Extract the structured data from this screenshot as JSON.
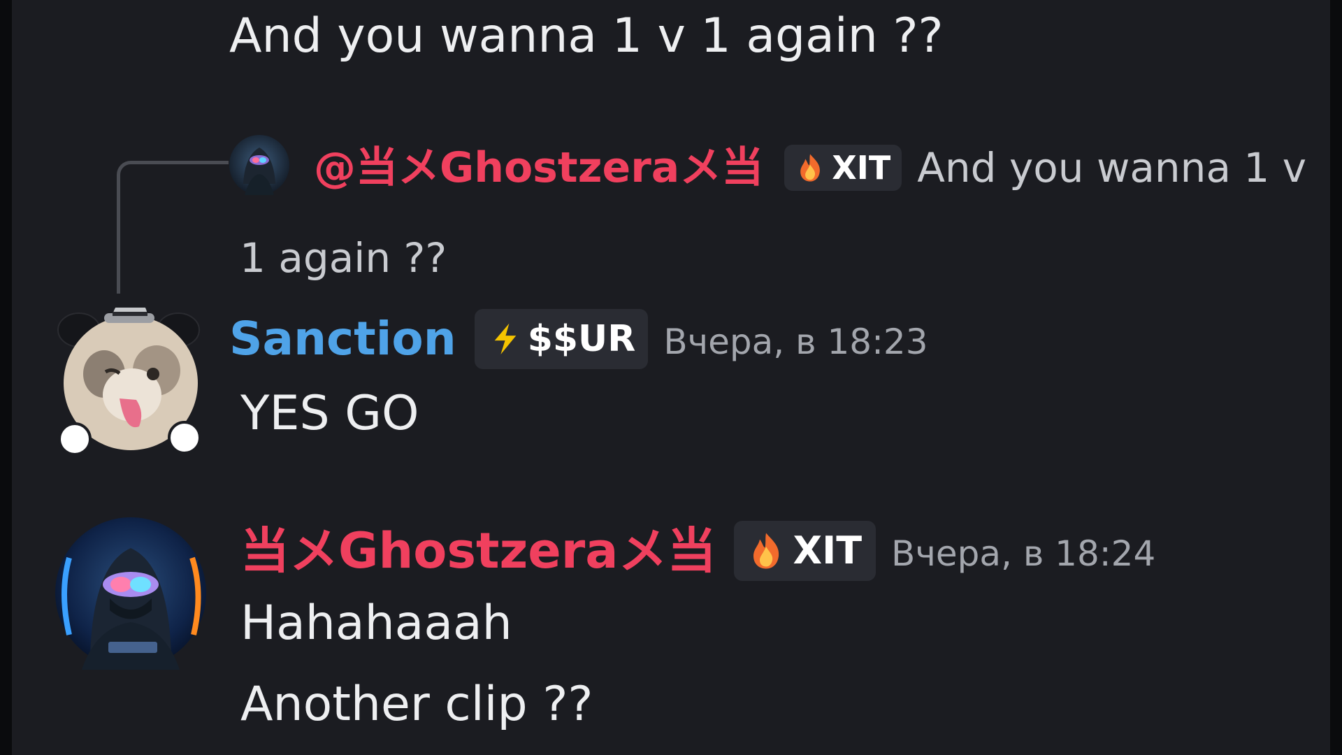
{
  "colors": {
    "background": "#1b1c21",
    "ghost_name": "#f0405e",
    "sanction_name": "#4fa3e8",
    "tag_bg": "#2a2c33",
    "timestamp": "#a3a6ad"
  },
  "top_message": {
    "text": "And you wanna  1 v 1 again ??"
  },
  "reply_preview": {
    "mention": "@当メGhostzeraメ当",
    "tag_icon": "fire-icon",
    "tag_label": "XIT",
    "text_line1": "And you wanna  1 v",
    "text_line2": "1 again ??"
  },
  "messages": [
    {
      "author": "Sanction",
      "tag_icon": "lightning-icon",
      "tag_label": "$$UR",
      "timestamp": "Вчера, в 18:23",
      "lines": [
        "YES GO"
      ]
    },
    {
      "author": "当メGhostzeraメ当",
      "tag_icon": "fire-icon",
      "tag_label": "XIT",
      "timestamp": "Вчера, в 18:24",
      "lines": [
        "Hahahaaah",
        "Another clip ??"
      ]
    }
  ]
}
